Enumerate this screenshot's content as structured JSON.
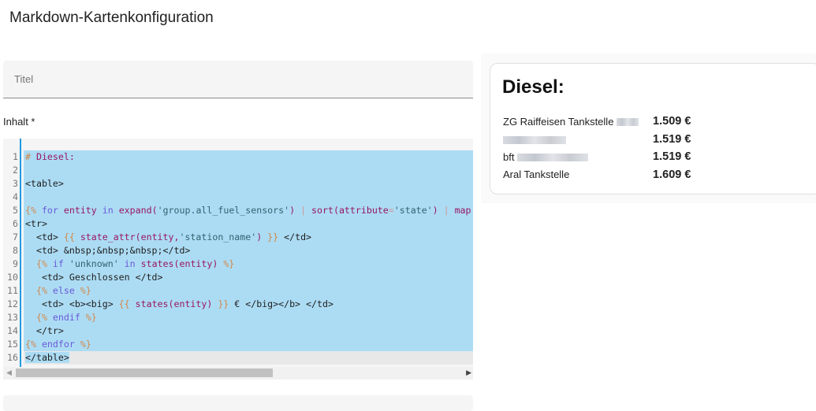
{
  "page_title": "Markdown-Kartenkonfiguration",
  "title_field": {
    "placeholder": "Titel",
    "value": ""
  },
  "content_label": "Inhalt *",
  "code_lines": [
    [
      [
        "delim",
        "# "
      ],
      [
        "fn",
        "Diesel:"
      ]
    ],
    [],
    [
      [
        "tag",
        "<table>"
      ]
    ],
    [],
    [
      [
        "delim",
        "{% "
      ],
      [
        "kw",
        "for "
      ],
      [
        "fn",
        "entity "
      ],
      [
        "kw",
        "in "
      ],
      [
        "fn",
        "expand("
      ],
      [
        "str",
        "'group.all_fuel_sensors'"
      ],
      [
        "fn",
        ") "
      ],
      [
        "op",
        "| "
      ],
      [
        "fn",
        "sort(attribute"
      ],
      [
        "op",
        "="
      ],
      [
        "str",
        "'state'"
      ],
      [
        "fn",
        ") "
      ],
      [
        "op",
        "| "
      ],
      [
        "fn",
        "map"
      ]
    ],
    [
      [
        "tag",
        "<tr>"
      ]
    ],
    [
      [
        "tag",
        "  <td> "
      ],
      [
        "delim",
        "{{ "
      ],
      [
        "fn",
        "state_attr(entity,"
      ],
      [
        "str",
        "'station_name'"
      ],
      [
        "fn",
        ") "
      ],
      [
        "delim",
        "}} "
      ],
      [
        "tag",
        "</td>"
      ]
    ],
    [
      [
        "tag",
        "  <td> &nbsp;&nbsp;&nbsp;</td>"
      ]
    ],
    [
      [
        "delim",
        "  {% "
      ],
      [
        "kw",
        "if "
      ],
      [
        "str",
        "'unknown' "
      ],
      [
        "kw",
        "in "
      ],
      [
        "fn",
        "states(entity) "
      ],
      [
        "delim",
        "%}"
      ]
    ],
    [
      [
        "tag",
        "   <td> Geschlossen </td>"
      ]
    ],
    [
      [
        "delim",
        "  {% "
      ],
      [
        "kw",
        "else "
      ],
      [
        "delim",
        "%}"
      ]
    ],
    [
      [
        "tag",
        "   <td> <b><big> "
      ],
      [
        "delim",
        "{{ "
      ],
      [
        "fn",
        "states(entity) "
      ],
      [
        "delim",
        "}} "
      ],
      [
        "tag",
        "€ </big></b> </td>"
      ]
    ],
    [
      [
        "delim",
        "  {% "
      ],
      [
        "kw",
        "endif "
      ],
      [
        "delim",
        "%}"
      ]
    ],
    [
      [
        "tag",
        "  </tr>"
      ]
    ],
    [
      [
        "delim",
        "{% "
      ],
      [
        "kw",
        "endfor "
      ],
      [
        "delim",
        "%}"
      ]
    ],
    [
      [
        "tag",
        "</table>"
      ]
    ]
  ],
  "preview": {
    "heading": "Diesel:",
    "rows": [
      {
        "name": "ZG Raiffeisen Tankstelle",
        "redacted": true,
        "price": "1.509 €"
      },
      {
        "name": "",
        "redacted": true,
        "price": "1.519 €"
      },
      {
        "name": "bft",
        "redacted": true,
        "price": "1.519 €"
      },
      {
        "name": "Aral Tankstelle",
        "redacted": false,
        "price": "1.609 €"
      }
    ]
  }
}
